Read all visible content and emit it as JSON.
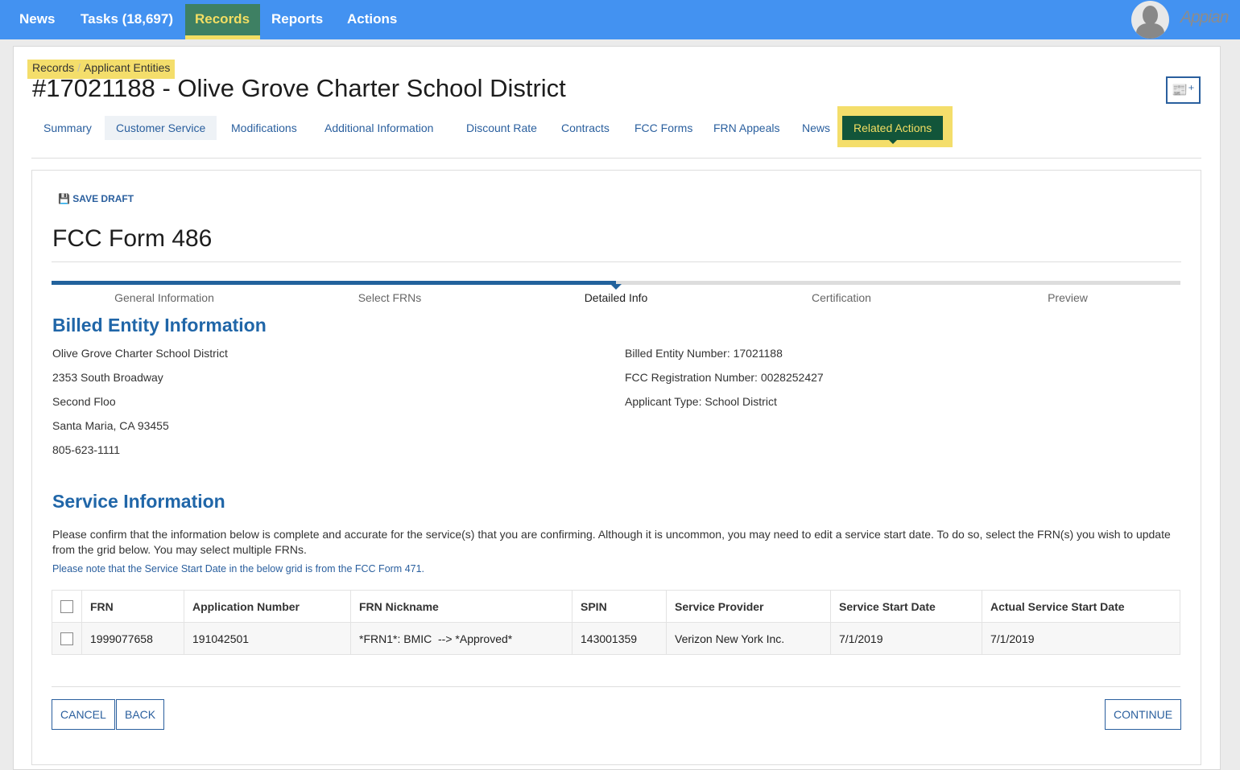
{
  "topnav": {
    "items": [
      "News",
      "Tasks (18,697)",
      "Records",
      "Reports",
      "Actions"
    ],
    "active": "Records",
    "logo": "Appian"
  },
  "breadcrumb": [
    "Records",
    "Applicant Entities"
  ],
  "page_title": "#17021188 - Olive Grove Charter School District",
  "tabs": [
    "Summary",
    "Customer Service",
    "Modifications",
    "Additional Information",
    "Discount Rate",
    "Contracts",
    "FCC Forms",
    "FRN Appeals",
    "News",
    "Related Actions"
  ],
  "form": {
    "save_draft": "SAVE DRAFT",
    "title": "FCC Form 486",
    "steps": [
      "General Information",
      "Select FRNs",
      "Detailed Info",
      "Certification",
      "Preview"
    ],
    "current_step": "Detailed Info",
    "progress_percent": 50,
    "billed": {
      "heading": "Billed Entity Information",
      "address": [
        "Olive Grove Charter School District",
        "2353 South Broadway",
        "Second Floo",
        "Santa Maria, CA 93455",
        "805-623-1111"
      ],
      "details": [
        "Billed Entity Number: 17021188",
        "FCC Registration Number: 0028252427",
        "Applicant Type: School District"
      ]
    },
    "service": {
      "heading": "Service Information",
      "paragraph": "Please confirm that the information below is complete and accurate for the service(s) that you are confirming. Although it is uncommon, you may need to edit a service start date. To do so, select the FRN(s) you wish to update from the grid below. You may select multiple FRNs.",
      "note": "Please note that the Service Start Date in the below grid is from the FCC Form 471.",
      "columns": [
        "FRN",
        "Application Number",
        "FRN Nickname",
        "SPIN",
        "Service Provider",
        "Service Start Date",
        "Actual Service Start Date"
      ],
      "rows": [
        [
          "1999077658",
          "191042501",
          "*FRN1*: BMIC  --> *Approved*",
          "143001359",
          "Verizon New York Inc.",
          "7/1/2019",
          "7/1/2019"
        ]
      ]
    },
    "buttons": {
      "cancel": "CANCEL",
      "back": "BACK",
      "continue": "CONTINUE"
    }
  }
}
